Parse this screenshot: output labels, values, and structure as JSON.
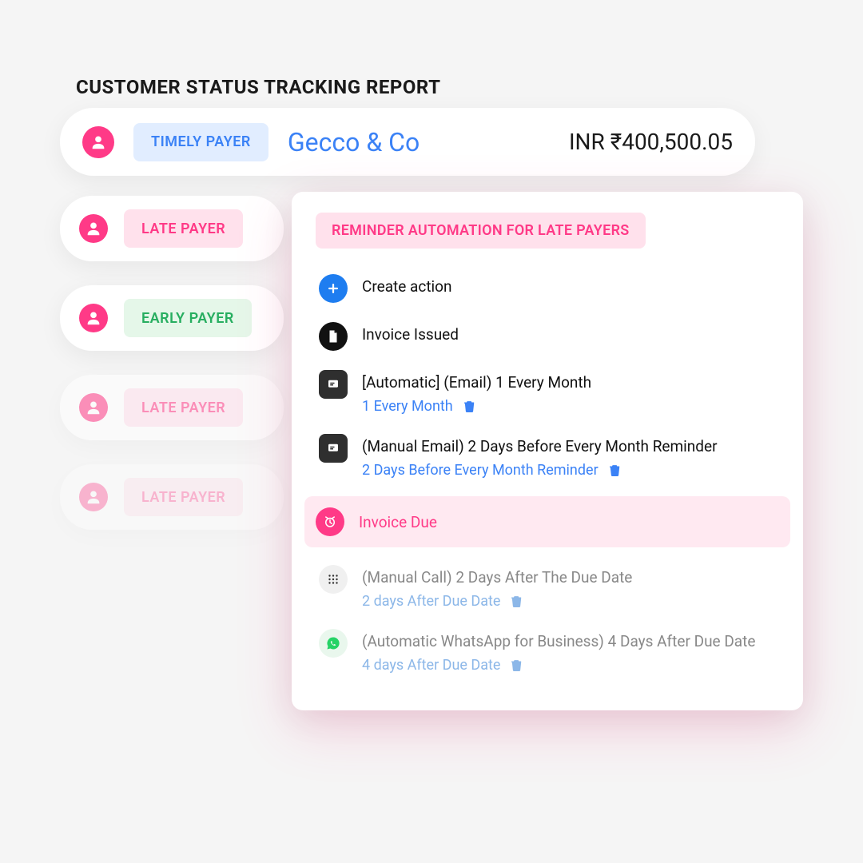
{
  "title": "CUSTOMER STATUS TRACKING REPORT",
  "featured": {
    "badge": "TIMELY PAYER",
    "company": "Gecco & Co",
    "amount": "INR ₹400,500.05"
  },
  "rows": [
    {
      "badge": "LATE PAYER",
      "type": "late"
    },
    {
      "badge": "EARLY PAYER",
      "type": "early"
    },
    {
      "badge": "LATE PAYER",
      "type": "late"
    },
    {
      "badge": "LATE PAYER",
      "type": "late"
    }
  ],
  "panel": {
    "title": "REMINDER AUTOMATION FOR LATE PAYERS",
    "create": "Create action",
    "invoice_issued": "Invoice Issued",
    "steps": [
      {
        "label": "[Automatic] (Email) 1 Every Month",
        "sub": "1 Every Month"
      },
      {
        "label": "(Manual Email) 2 Days Before Every Month Reminder",
        "sub": "2 Days Before Every Month Reminder"
      }
    ],
    "invoice_due": "Invoice Due",
    "after": [
      {
        "label": "(Manual Call) 2 Days After The Due Date",
        "sub": "2 days After Due Date"
      },
      {
        "label": "(Automatic WhatsApp for Business) 4 Days After Due Date",
        "sub": "4 days After Due Date"
      }
    ]
  }
}
